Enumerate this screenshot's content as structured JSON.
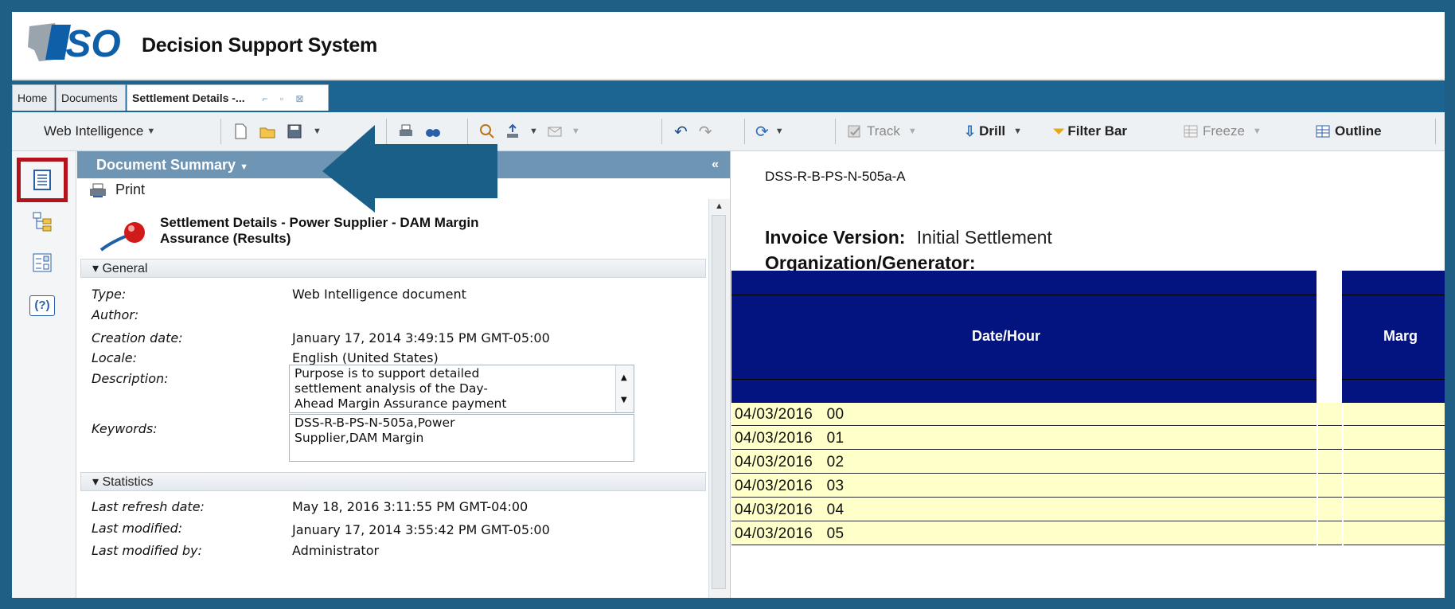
{
  "app": {
    "logo_text": "ISO",
    "title": "Decision Support System"
  },
  "tabs": [
    {
      "label": "Home"
    },
    {
      "label": "Documents"
    },
    {
      "label": "Settlement Details -..."
    }
  ],
  "toolbar": {
    "web_intelligence": "Web Intelligence",
    "track": "Track",
    "drill": "Drill",
    "filter_bar": "Filter Bar",
    "freeze": "Freeze",
    "outline": "Outline"
  },
  "panel": {
    "header": "Document Summary",
    "collapse": "«",
    "print": "Print",
    "doc_title_line1": "Settlement Details - Power Supplier - DAM Margin",
    "doc_title_line2": "Assurance (Results)",
    "general": {
      "header": "General",
      "type_label": "Type:",
      "type_value": "Web Intelligence document",
      "author_label": "Author:",
      "creation_label": "Creation date:",
      "creation_value": "January 17, 2014 3:49:15 PM GMT-05:00",
      "locale_label": "Locale:",
      "locale_value": "English (United States)",
      "description_label": "Description:",
      "description_line1": "Purpose is to support detailed",
      "description_line2": "settlement analysis of the Day-",
      "description_line3": "Ahead Margin Assurance payment",
      "keywords_label": "Keywords:",
      "keywords_line1": "DSS-R-B-PS-N-505a,Power",
      "keywords_line2": "Supplier,DAM Margin"
    },
    "statistics": {
      "header": "Statistics",
      "refresh_label": "Last refresh date:",
      "refresh_value": "May 18, 2016 3:11:55 PM GMT-04:00",
      "modified_label": "Last modified:",
      "modified_value": "January 17, 2014 3:55:42 PM GMT-05:00",
      "modified_by_label": "Last modified by:",
      "modified_by_value": "Administrator"
    }
  },
  "report": {
    "code": "DSS-R-B-PS-N-505a-A",
    "invoice_label": "Invoice Version:",
    "invoice_value": "Initial Settlement",
    "org_label": "Organization/Generator:",
    "col_date_hour": "Date/Hour",
    "col_margin": "Marg",
    "rows": [
      "04/03/2016 00",
      "04/03/2016 01",
      "04/03/2016 02",
      "04/03/2016 03",
      "04/03/2016 04",
      "04/03/2016 05"
    ]
  },
  "colors": {
    "frame": "#1f5f86",
    "tabbar": "#1c6592",
    "panel_header": "#6f95b4",
    "table_header": "#03137f",
    "table_cell": "#ffffc9",
    "highlight": "#b3141c",
    "arrow": "#1a5f88"
  }
}
